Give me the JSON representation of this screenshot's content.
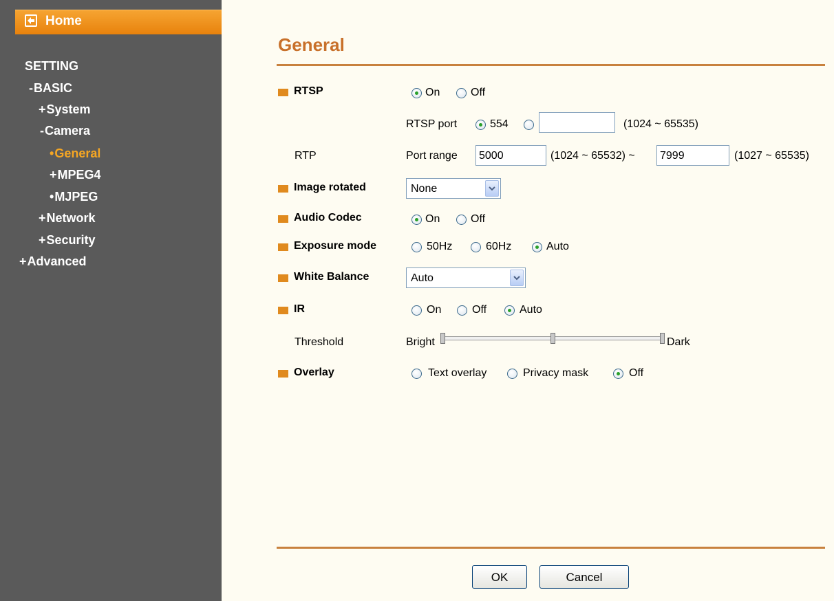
{
  "sidebar": {
    "home_label": "Home",
    "setting_label": "SETTING",
    "items": [
      {
        "prefix": "-",
        "label": "BASIC"
      },
      {
        "prefix": "+",
        "label": "System"
      },
      {
        "prefix": "-",
        "label": "Camera"
      },
      {
        "prefix": "•",
        "label": "General"
      },
      {
        "prefix": "+",
        "label": "MPEG4"
      },
      {
        "prefix": "•",
        "label": "MJPEG"
      },
      {
        "prefix": "+",
        "label": "Network"
      },
      {
        "prefix": "+",
        "label": "Security"
      },
      {
        "prefix": "+",
        "label": "Advanced"
      }
    ],
    "active_item": "General",
    "active_color": "#f5a623"
  },
  "page": {
    "title": "General",
    "accent_color": "#c8702a"
  },
  "rtsp": {
    "label": "RTSP",
    "on_label": "On",
    "off_label": "Off",
    "selected": "On",
    "port_label": "RTSP port",
    "port_default": "554",
    "port_custom_value": "",
    "port_range": "(1024 ~ 65535)",
    "port_selected": "554"
  },
  "rtp": {
    "label": "RTP",
    "port_range_label": "Port range",
    "start_value": "5000",
    "start_range": "(1024 ~ 65532) ~",
    "end_value": "7999",
    "end_range": "(1027 ~ 65535)"
  },
  "image_rotated": {
    "label": "Image rotated",
    "value": "None"
  },
  "audio_codec": {
    "label": "Audio Codec",
    "on_label": "On",
    "off_label": "Off",
    "selected": "On"
  },
  "exposure_mode": {
    "label": "Exposure mode",
    "options": [
      "50Hz",
      "60Hz",
      "Auto"
    ],
    "selected": "Auto"
  },
  "white_balance": {
    "label": "White Balance",
    "value": "Auto"
  },
  "ir": {
    "label": "IR",
    "options": [
      "On",
      "Off",
      "Auto"
    ],
    "selected": "Auto"
  },
  "threshold": {
    "label": "Threshold",
    "min_label": "Bright",
    "max_label": "Dark",
    "level": 0.5
  },
  "overlay": {
    "label": "Overlay",
    "options": [
      "Text overlay",
      "Privacy mask",
      "Off"
    ],
    "selected": "Off"
  },
  "buttons": {
    "ok_label": "OK",
    "cancel_label": "Cancel"
  }
}
